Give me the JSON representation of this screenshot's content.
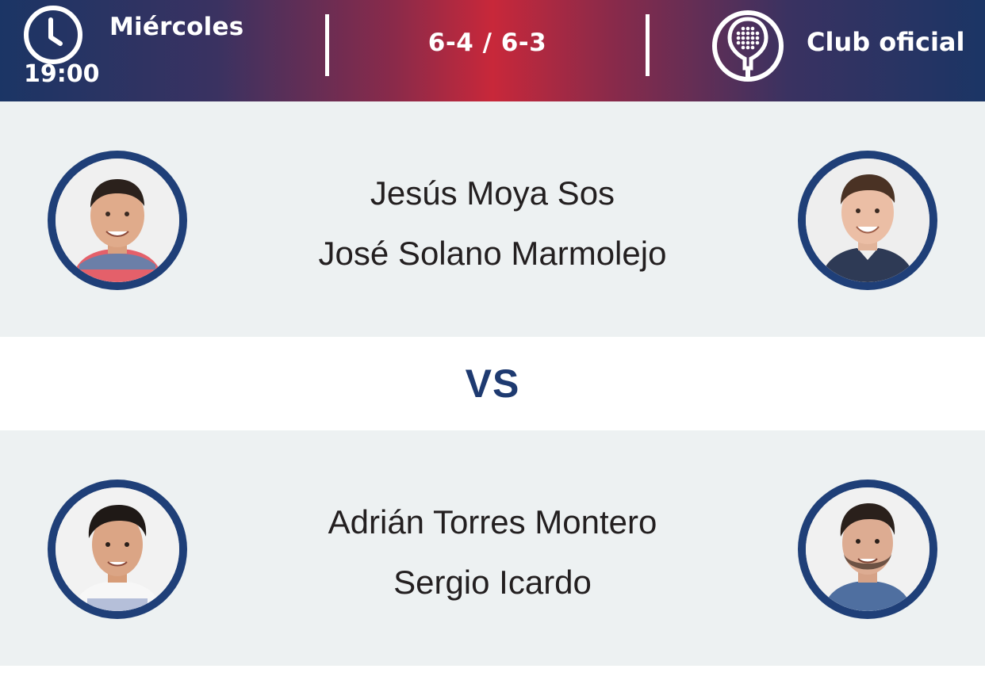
{
  "header": {
    "day": "Miércoles",
    "time": "19:00",
    "score": "6-4 / 6-3",
    "club": "Club oficial",
    "icons": [
      "clock-icon",
      "padel-racket-icon"
    ]
  },
  "teams": [
    {
      "players": [
        "Jesús Moya Sos",
        "José Solano Marmolejo"
      ],
      "avatars": [
        "player-photo-jesus-moya",
        "player-photo-jose-solano"
      ]
    },
    {
      "players": [
        "Adrián Torres Montero",
        "Sergio Icardo"
      ],
      "avatars": [
        "player-photo-adrian-torres",
        "player-photo-sergio-icardo"
      ]
    }
  ],
  "versus": "VS",
  "colors": {
    "header_gradient_edge": "#1b3565",
    "header_gradient_center": "#c8283a",
    "avatar_ring": "#1f3f78",
    "team_background": "#edf1f2",
    "vs_text": "#1e3a70",
    "name_text": "#231f20"
  }
}
